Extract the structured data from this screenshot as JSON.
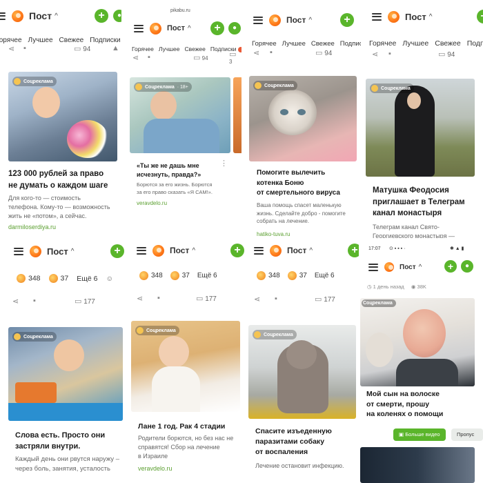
{
  "header": {
    "title": "Пост",
    "chevron": "^",
    "plus": "+"
  },
  "tabs": [
    "Горячее",
    "Лучшее",
    "Свежее",
    "Подписки"
  ],
  "status_bar": {
    "url": "pikabu.ru",
    "time": "17:07"
  },
  "badge_text": "Соцреклама",
  "panels": {
    "p1": {
      "comments": "94",
      "title_lines": [
        "123 000 рублей за право",
        "не думать о каждом шаге"
      ],
      "desc_lines": [
        "Для кого-то — стоимость",
        "телефона. Кому-то — возможность",
        "жить не «потом», а сейчас."
      ],
      "link": "darmiloserdiya.ru"
    },
    "p2": {
      "comments": "94",
      "comments2": "3",
      "badge_extra": "· 18+",
      "title_lines": [
        "«Ты же не дашь мне",
        "исчезнуть, правда?»"
      ],
      "desc_lines": [
        "Борются за его жизнь. Борются",
        "за его право сказать «Я САМ!»."
      ],
      "link": "veravdelo.ru"
    },
    "p3": {
      "comments": "94",
      "title_lines": [
        "Помогите вылечить",
        "котенка Боню",
        "от смертельного вируса"
      ],
      "desc_lines": [
        "Ваша помощь спасет маленькую",
        "жизнь. Сделайте добро - помогите",
        "собрать на лечение."
      ],
      "link": "hatiko-tuva.ru"
    },
    "p4": {
      "comments": "94",
      "title_lines": [
        "Матушка Феодосия",
        "приглашает в Телеграм",
        "канал монастыря"
      ],
      "desc_lines": [
        "Телеграм канал Свято-",
        "Георгиевского монастыря —"
      ]
    },
    "p5": {
      "reactions": [
        {
          "count": "348"
        },
        {
          "count": "37"
        }
      ],
      "more": "Ещё 6",
      "comments": "177",
      "title_lines": [
        "Слова есть. Просто они",
        "застряли внутри."
      ],
      "desc_lines": [
        "Каждый день они рвутся наружу –",
        "через боль, занятия, усталость"
      ]
    },
    "p6": {
      "reactions": [
        {
          "count": "348"
        },
        {
          "count": "37"
        }
      ],
      "more": "Ещё 6",
      "comments": "177",
      "title_lines": [
        "Лане 1 год. Рак 4 стадии"
      ],
      "desc_lines": [
        "Родители борются, но без нас не",
        "справятся! Сбор на лечение",
        "в Израиле"
      ],
      "link": "veravdelo.ru"
    },
    "p7": {
      "reactions": [
        {
          "count": "348"
        },
        {
          "count": "37"
        }
      ],
      "more": "Ещё 6",
      "comments": "177",
      "title_lines": [
        "Спасите изъеденную",
        "паразитами собаку",
        "от воспаления"
      ],
      "desc_lines": [
        "Лечение остановит инфекцию."
      ]
    },
    "p8": {
      "meta": "1 день назад",
      "views": "38K",
      "title_lines": [
        "Мой сын на волоске",
        "от смерти, прошу",
        "на коленях о помощи"
      ],
      "btn_more": "Больше видео",
      "btn_skip": "Пропус"
    }
  },
  "colors": {
    "accent_green": "#5ab52b",
    "link_green": "#5a9f2f",
    "logo_orange": "#ff7a1a"
  }
}
